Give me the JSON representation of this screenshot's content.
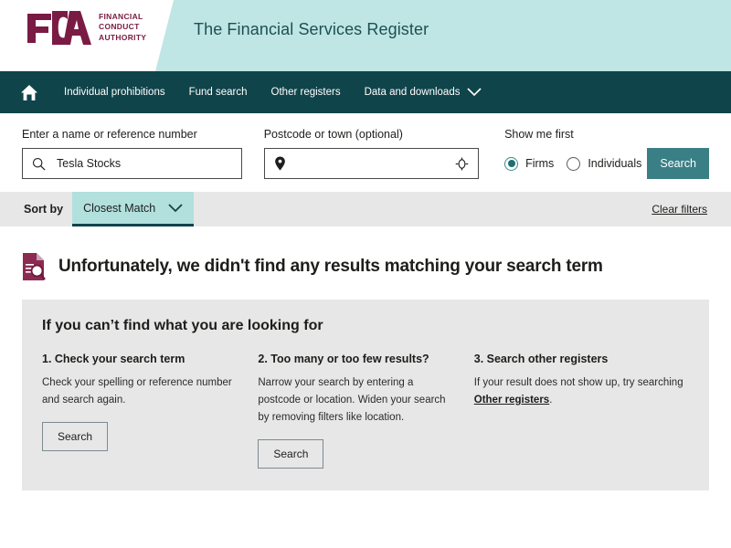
{
  "header": {
    "logo_lines": [
      "FINANCIAL",
      "CONDUCT",
      "AUTHORITY"
    ],
    "logo_letters": "FCA",
    "title": "The Financial Services Register",
    "brand_maroon": "#7a1b44",
    "banner_teal": "#bfe6e4"
  },
  "nav": {
    "home_icon": "home-icon",
    "items": [
      {
        "label": "Individual prohibitions",
        "has_chevron": false
      },
      {
        "label": "Fund search",
        "has_chevron": false
      },
      {
        "label": "Other registers",
        "has_chevron": false
      },
      {
        "label": "Data and downloads",
        "has_chevron": true
      }
    ],
    "bar_color": "#10444b"
  },
  "search": {
    "name_label": "Enter a name or reference number",
    "name_value": "Tesla Stocks",
    "name_placeholder": "Enter a name or reference number",
    "name_icon": "search-icon",
    "postcode_label": "Postcode or town (optional)",
    "postcode_value": "",
    "postcode_placeholder": "",
    "postcode_icon": "map-pin-icon",
    "locate_icon": "crosshair-icon",
    "show_me_first_label": "Show me first",
    "options": [
      {
        "label": "Firms",
        "selected": true
      },
      {
        "label": "Individuals",
        "selected": false
      }
    ],
    "submit_label": "Search",
    "submit_color": "#3b7f86"
  },
  "sortbar": {
    "label": "Sort by",
    "selected_value": "Closest Match",
    "chevron_icon": "chevron-down-icon",
    "clear_filters_label": "Clear filters",
    "background": "#e7e7e7",
    "select_background": "#b2e0dd"
  },
  "results": {
    "icon": "document-search-icon",
    "message": "Unfortunately, we didn't find any results matching your search term"
  },
  "help_panel": {
    "title": "If you can’t find what you are looking for",
    "columns": [
      {
        "title": "1. Check your search term",
        "body": "Check your spelling or reference number and search again.",
        "button_label": "Search",
        "link_text": "",
        "body_after_link": ""
      },
      {
        "title": "2. Too many or too few results?",
        "body": "Narrow your search by entering a postcode or location. Widen your search by removing filters like location.",
        "button_label": "Search",
        "link_text": "",
        "body_after_link": ""
      },
      {
        "title": "3. Search other registers",
        "body": "If your result does not show up, try searching ",
        "button_label": "",
        "link_text": "Other registers",
        "body_after_link": "."
      }
    ]
  }
}
